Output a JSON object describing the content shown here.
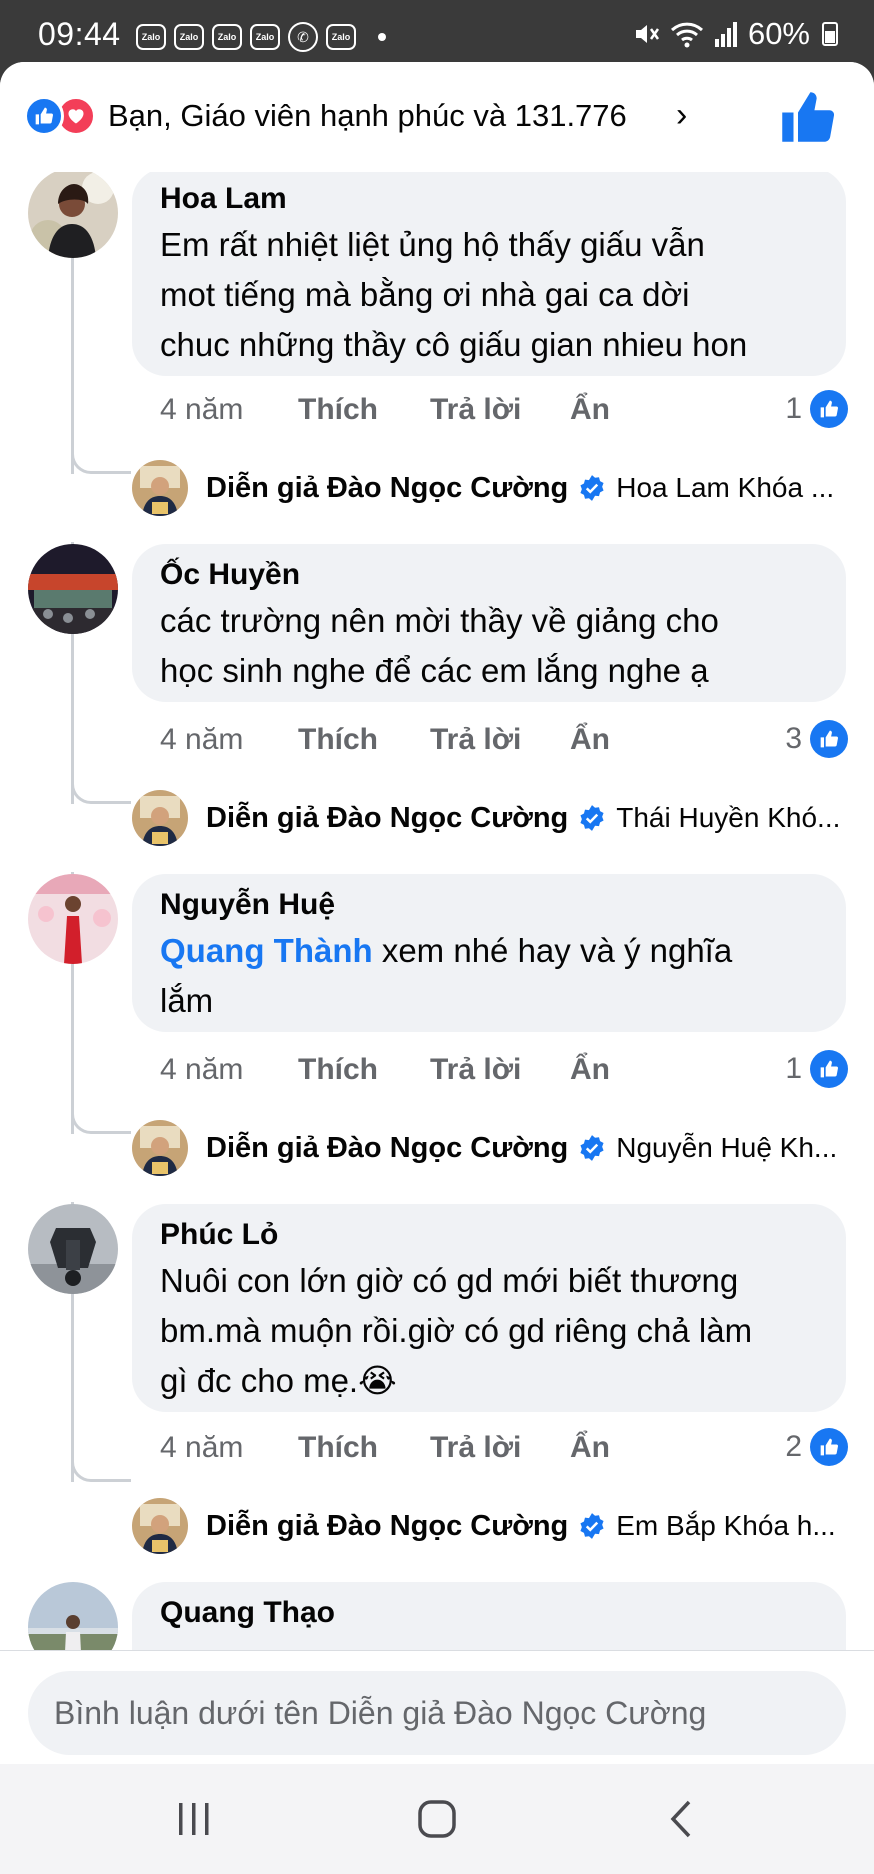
{
  "status": {
    "time": "09:44",
    "zalo_label": "Zalo",
    "battery": "60%"
  },
  "header": {
    "reactions_text": "Bạn, Giáo viên hạnh phúc và 131.776",
    "chevron": "›"
  },
  "comments": [
    {
      "name": "Hoa Lam",
      "text_lines": [
        "Em rất nhiệt liệt ủng hộ thấy giấu vẫn",
        "mot tiếng mà bằng ơi nhà gai ca dời",
        "chuc những thầy cô giấu gian nhieu hon"
      ],
      "time": "4 năm",
      "like": "Thích",
      "reply": "Trả lời",
      "hide": "Ẩn",
      "reaction_count": "1",
      "reply_author": "Diễn giả Đào Ngọc Cường",
      "reply_preview": "Hoa Lam Khóa ..."
    },
    {
      "name": "Ốc Huyền",
      "text_lines": [
        "các trường nên mời thầy về giảng cho",
        "học sinh nghe để các em lắng nghe ạ"
      ],
      "time": "4 năm",
      "like": "Thích",
      "reply": "Trả lời",
      "hide": "Ẩn",
      "reaction_count": "3",
      "reply_author": "Diễn giả Đào Ngọc Cường",
      "reply_preview": "Thái Huyền Khó..."
    },
    {
      "name": "Nguyễn Huệ",
      "mention": "Quang Thành",
      "text_lines": [
        " xem nhé hay và ý nghĩa",
        "lắm"
      ],
      "time": "4 năm",
      "like": "Thích",
      "reply": "Trả lời",
      "hide": "Ẩn",
      "reaction_count": "1",
      "reply_author": "Diễn giả Đào Ngọc Cường",
      "reply_preview": "Nguyễn Huệ Kh..."
    },
    {
      "name": "Phúc Lỏ",
      "text_lines": [
        "Nuôi con lớn giờ có gd mới biết thương",
        "bm.mà muộn rồi.giờ có gd riêng chả làm",
        "gì đc cho mẹ.😭"
      ],
      "time": "4 năm",
      "like": "Thích",
      "reply": "Trả lời",
      "hide": "Ẩn",
      "reaction_count": "2",
      "reply_author": "Diễn giả Đào Ngọc Cường",
      "reply_preview": "Em Bắp Khóa h..."
    },
    {
      "name": "Quang Thạo"
    }
  ],
  "composer": {
    "placeholder": "Bình luận dưới tên Diễn giả Đào Ngọc Cường"
  },
  "colors": {
    "accent": "#1877f2",
    "love": "#f33e58",
    "bubble": "#f0f2f5",
    "muted": "#65676b"
  },
  "icons": {
    "like": "like-icon",
    "love": "love-icon",
    "verified": "verified-badge-icon",
    "nav_recent": "recent-apps-icon",
    "nav_home": "home-icon",
    "nav_back": "back-icon"
  }
}
